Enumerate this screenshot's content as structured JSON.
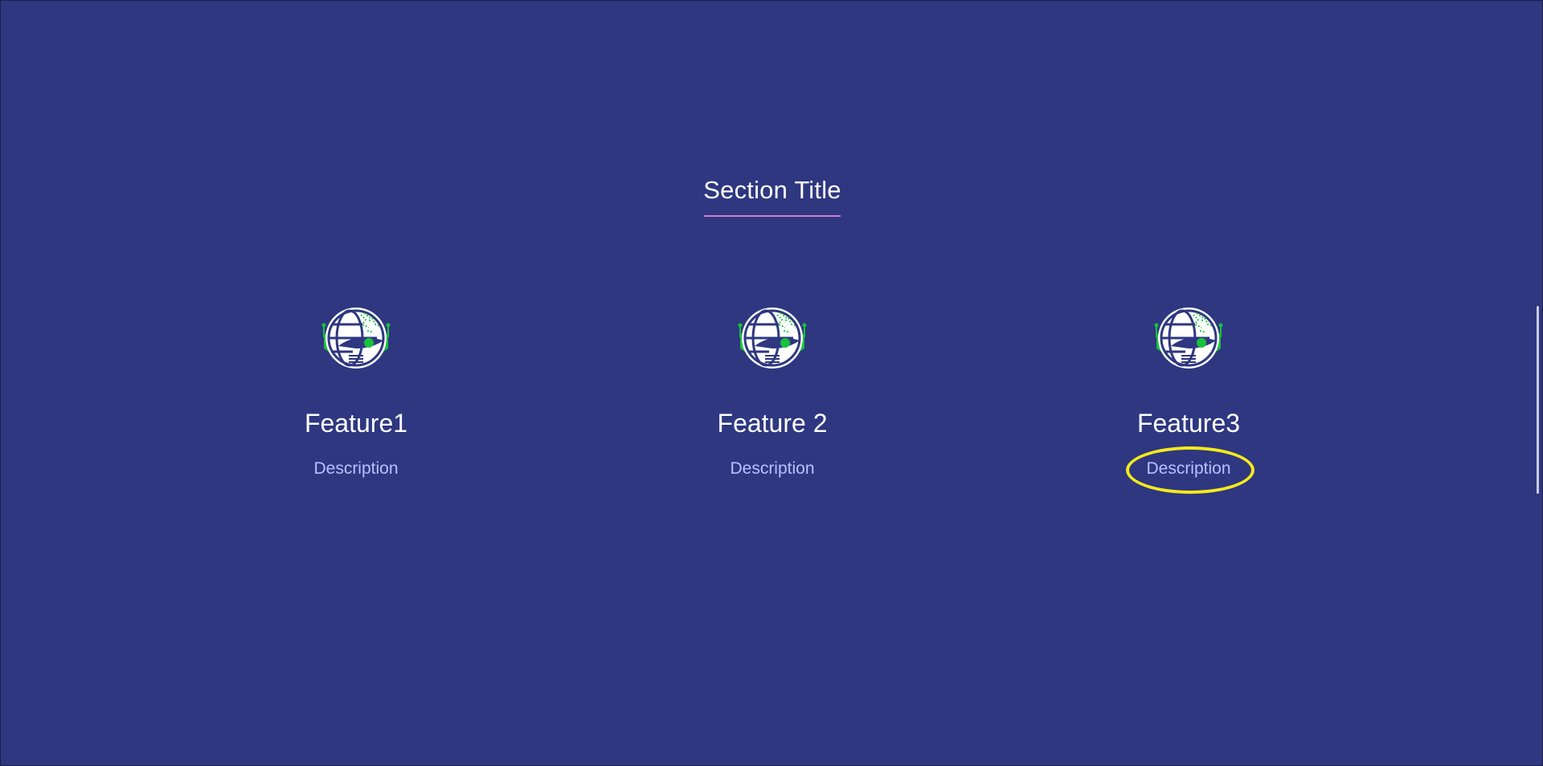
{
  "section": {
    "title": "Section Title",
    "underline_color": "#d47ad6"
  },
  "features": [
    {
      "title": "Feature1",
      "description": "Description",
      "icon": "globe-robot-icon"
    },
    {
      "title": "Feature 2",
      "description": "Description",
      "icon": "globe-robot-icon"
    },
    {
      "title": "Feature3",
      "description": "Description",
      "icon": "globe-robot-icon",
      "highlighted": true
    }
  ],
  "colors": {
    "background": "#2e3780",
    "title_text": "#ffffff",
    "description_text": "#b8c2ff",
    "icon_accent": "#19c23a",
    "highlight": "#f5ea1b"
  }
}
